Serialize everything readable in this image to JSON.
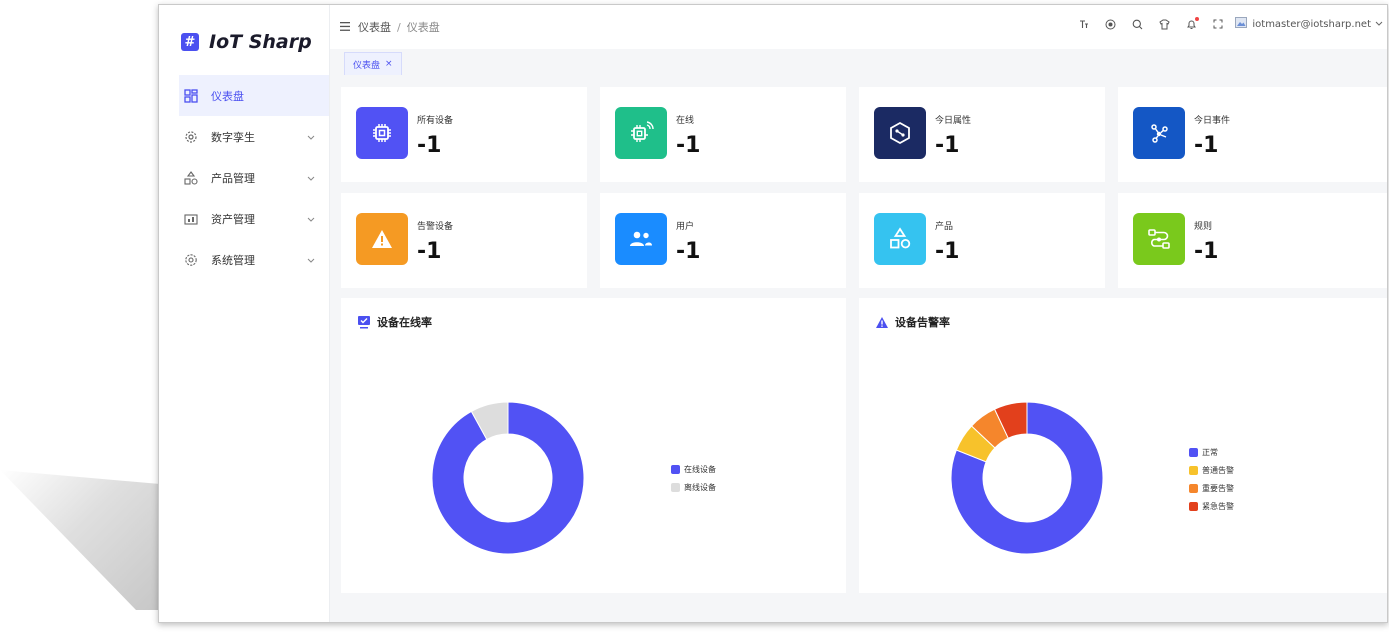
{
  "app": {
    "logo_mark": "#",
    "name": "IoT Sharp"
  },
  "sidebar": {
    "items": [
      {
        "label": "仪表盘",
        "icon": "dashboard-icon",
        "active": true
      },
      {
        "label": "数字孪生",
        "icon": "twin-gear-icon"
      },
      {
        "label": "产品管理",
        "icon": "shapes-icon"
      },
      {
        "label": "资产管理",
        "icon": "asset-icon"
      },
      {
        "label": "系统管理",
        "icon": "settings-icon"
      }
    ]
  },
  "header": {
    "breadcrumb": [
      "仪表盘",
      "仪表盘"
    ],
    "separator": "/",
    "user_email": "iotmaster@iotsharp.net",
    "tools": [
      "font-size-icon",
      "github-icon",
      "search-icon",
      "theme-icon",
      "bell-icon",
      "fullscreen-icon"
    ]
  },
  "tabs": [
    {
      "label": "仪表盘",
      "close": "×"
    }
  ],
  "stats": [
    {
      "label": "所有设备",
      "value": "-1",
      "color": "#5152f4",
      "icon": "chip-icon"
    },
    {
      "label": "在线",
      "value": "-1",
      "color": "#1fbf8a",
      "icon": "chip-signal-icon"
    },
    {
      "label": "今日属性",
      "value": "-1",
      "color": "#1b2a63",
      "icon": "hexagon-link-icon"
    },
    {
      "label": "今日事件",
      "value": "-1",
      "color": "#1457c5",
      "icon": "event-flow-icon"
    },
    {
      "label": "告警设备",
      "value": "-1",
      "color": "#f59a23",
      "icon": "warning-icon"
    },
    {
      "label": "用户",
      "value": "-1",
      "color": "#1a8cff",
      "icon": "users-icon"
    },
    {
      "label": "产品",
      "value": "-1",
      "color": "#35c3f0",
      "icon": "product-shapes-icon"
    },
    {
      "label": "规则",
      "value": "-1",
      "color": "#7ac91c",
      "icon": "rule-flow-icon"
    }
  ],
  "panels": {
    "online": {
      "title": "设备在线率"
    },
    "alarm": {
      "title": "设备告警率"
    }
  },
  "chart_data": [
    {
      "type": "pie",
      "title": "设备在线率",
      "donut": true,
      "categories": [
        "在线设备",
        "离线设备"
      ],
      "values": [
        92,
        8
      ],
      "colors": [
        "#5152f4",
        "#dddddd"
      ],
      "legend": "right"
    },
    {
      "type": "pie",
      "title": "设备告警率",
      "donut": true,
      "categories": [
        "正常",
        "普通告警",
        "重要告警",
        "紧急告警"
      ],
      "values": [
        81,
        6,
        6,
        7
      ],
      "colors": [
        "#5152f4",
        "#f7c22b",
        "#f5862c",
        "#e2401c"
      ],
      "legend": "right"
    }
  ]
}
